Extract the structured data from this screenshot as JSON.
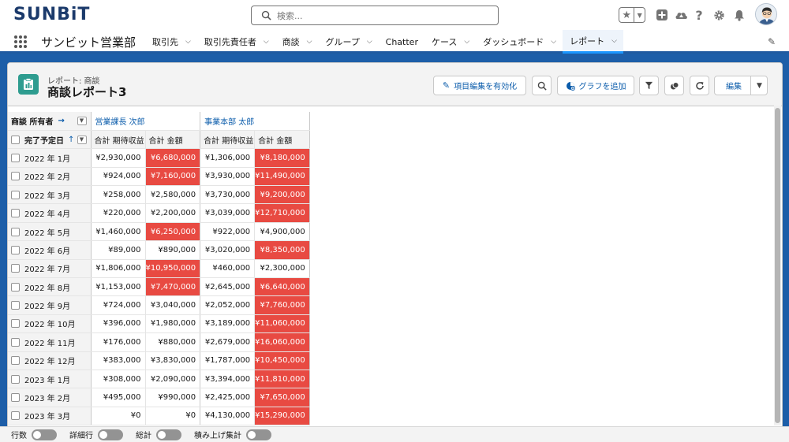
{
  "header": {
    "logo_main": "SUNBiT",
    "search_placeholder": "検索...",
    "icons": [
      "star-icon",
      "chevron-down-icon",
      "plus-icon",
      "cloud-icon",
      "help-icon",
      "gear-icon",
      "bell-icon",
      "avatar"
    ]
  },
  "nav": {
    "app_name": "サンビット営業部",
    "items": [
      {
        "label": "取引先",
        "chevron": true
      },
      {
        "label": "取引先責任者",
        "chevron": true
      },
      {
        "label": "商談",
        "chevron": true
      },
      {
        "label": "グループ",
        "chevron": true
      },
      {
        "label": "Chatter",
        "chevron": false
      },
      {
        "label": "ケース",
        "chevron": true
      },
      {
        "label": "ダッシュボード",
        "chevron": true
      },
      {
        "label": "レポート",
        "chevron": true,
        "active": true
      }
    ]
  },
  "report": {
    "breadcrumb": "レポート: 商談",
    "title": "商談レポート3",
    "buttons": {
      "enable_edit": "項目編集を有効化",
      "add_chart": "グラフを追加",
      "edit": "編集"
    }
  },
  "table": {
    "owner_header": "商談 所有者",
    "owner_arrow": "→",
    "date_header": "完了予定日",
    "date_sort": "↑",
    "groups": [
      "営業課長 次郎",
      "事業本部 太郎"
    ],
    "sub_headers": [
      "合計 期待収益",
      "合計 金額",
      "合計 期待収益",
      "合計 金額"
    ],
    "rows": [
      {
        "month": "2022 年 1月",
        "values": [
          "¥2,930,000",
          "¥6,680,000",
          "¥1,306,000",
          "¥8,180,000"
        ],
        "hi": [
          false,
          true,
          false,
          true
        ]
      },
      {
        "month": "2022 年 2月",
        "values": [
          "¥924,000",
          "¥7,160,000",
          "¥3,930,000",
          "¥11,490,000"
        ],
        "hi": [
          false,
          true,
          false,
          true
        ]
      },
      {
        "month": "2022 年 3月",
        "values": [
          "¥258,000",
          "¥2,580,000",
          "¥3,730,000",
          "¥9,200,000"
        ],
        "hi": [
          false,
          false,
          false,
          true
        ]
      },
      {
        "month": "2022 年 4月",
        "values": [
          "¥220,000",
          "¥2,200,000",
          "¥3,039,000",
          "¥12,710,000"
        ],
        "hi": [
          false,
          false,
          false,
          true
        ]
      },
      {
        "month": "2022 年 5月",
        "values": [
          "¥1,460,000",
          "¥6,250,000",
          "¥922,000",
          "¥4,900,000"
        ],
        "hi": [
          false,
          true,
          false,
          false
        ]
      },
      {
        "month": "2022 年 6月",
        "values": [
          "¥89,000",
          "¥890,000",
          "¥3,020,000",
          "¥8,350,000"
        ],
        "hi": [
          false,
          false,
          false,
          true
        ]
      },
      {
        "month": "2022 年 7月",
        "values": [
          "¥1,806,000",
          "¥10,950,000",
          "¥460,000",
          "¥2,300,000"
        ],
        "hi": [
          false,
          true,
          false,
          false
        ]
      },
      {
        "month": "2022 年 8月",
        "values": [
          "¥1,153,000",
          "¥7,470,000",
          "¥2,645,000",
          "¥6,640,000"
        ],
        "hi": [
          false,
          true,
          false,
          true
        ]
      },
      {
        "month": "2022 年 9月",
        "values": [
          "¥724,000",
          "¥3,040,000",
          "¥2,052,000",
          "¥7,760,000"
        ],
        "hi": [
          false,
          false,
          false,
          true
        ]
      },
      {
        "month": "2022 年 10月",
        "values": [
          "¥396,000",
          "¥1,980,000",
          "¥3,189,000",
          "¥11,060,000"
        ],
        "hi": [
          false,
          false,
          false,
          true
        ]
      },
      {
        "month": "2022 年 11月",
        "values": [
          "¥176,000",
          "¥880,000",
          "¥2,679,000",
          "¥16,060,000"
        ],
        "hi": [
          false,
          false,
          false,
          true
        ]
      },
      {
        "month": "2022 年 12月",
        "values": [
          "¥383,000",
          "¥3,830,000",
          "¥1,787,000",
          "¥10,450,000"
        ],
        "hi": [
          false,
          false,
          false,
          true
        ]
      },
      {
        "month": "2023 年 1月",
        "values": [
          "¥308,000",
          "¥2,090,000",
          "¥3,394,000",
          "¥11,810,000"
        ],
        "hi": [
          false,
          false,
          false,
          true
        ]
      },
      {
        "month": "2023 年 2月",
        "values": [
          "¥495,000",
          "¥990,000",
          "¥2,425,000",
          "¥7,650,000"
        ],
        "hi": [
          false,
          false,
          false,
          true
        ]
      },
      {
        "month": "2023 年 3月",
        "values": [
          "¥0",
          "¥0",
          "¥4,130,000",
          "¥15,290,000"
        ],
        "hi": [
          false,
          false,
          false,
          true
        ]
      }
    ]
  },
  "footer": {
    "toggles": [
      "行数",
      "詳細行",
      "総計",
      "積み上げ集計"
    ]
  },
  "colors": {
    "highlight": "#e84a42",
    "brand_blue": "#1d5ea8",
    "link": "#0b5cab",
    "report_icon": "#2e9c8f"
  }
}
